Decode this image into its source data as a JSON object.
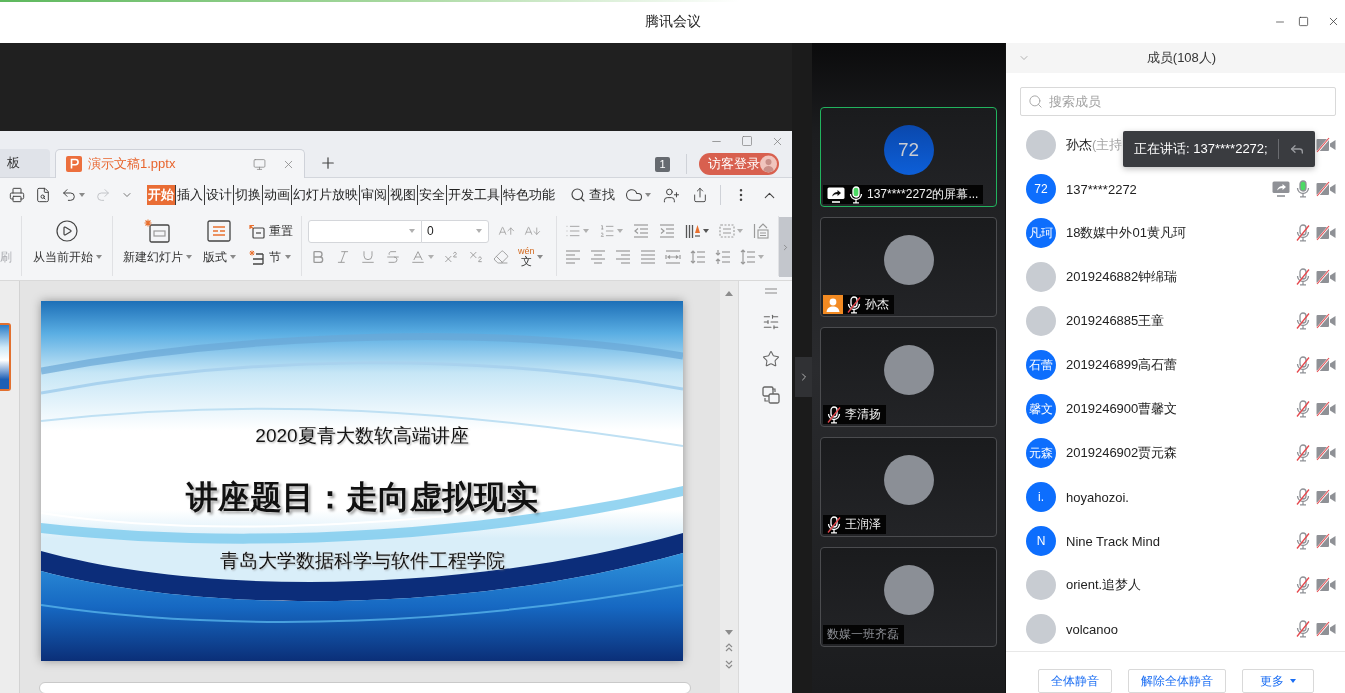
{
  "window": {
    "title": "腾讯会议"
  },
  "presentation": {
    "app_tabs": [
      {
        "label": "板",
        "selected": false
      },
      {
        "label": "演示文稿1.pptx",
        "selected": true
      }
    ],
    "notification_count": "1",
    "login_button": "访客登录",
    "redo": {
      "disabled": true
    },
    "menu_tabs": [
      {
        "label": "开始",
        "selected": true
      },
      {
        "label": "插入",
        "selected": false
      },
      {
        "label": "设计",
        "selected": false
      },
      {
        "label": "切换",
        "selected": false
      },
      {
        "label": "动画",
        "selected": false
      },
      {
        "label": "幻灯片放映",
        "selected": false
      },
      {
        "label": "审阅",
        "selected": false
      },
      {
        "label": "视图",
        "selected": false
      },
      {
        "label": "安全",
        "selected": false
      },
      {
        "label": "开发工具",
        "selected": false
      },
      {
        "label": "特色功能",
        "selected": false
      }
    ],
    "find_button": "查找",
    "ribbon": {
      "format_painter": {
        "label": "刷",
        "disabled": true
      },
      "play_button": "从当前开始",
      "new_slide_button": "新建幻灯片",
      "layout_button": "版式",
      "reset_button": "重置",
      "section_button": "节",
      "font_size": "0",
      "phonetic_button": {
        "pinyin": "wén",
        "character": "文"
      }
    },
    "slide": {
      "heading": "2020夏青大数软高端讲座",
      "title": "讲座题目：走向虚拟现实",
      "subtitle": "青岛大学数据科学与软件工程学院"
    }
  },
  "video_tiles": [
    {
      "name": "137****2272的屏幕...",
      "avatar": {
        "kind": "initials",
        "text": "72"
      },
      "speaking": true,
      "sharing": true,
      "host": false,
      "audio_connected": true,
      "muted": false
    },
    {
      "name": "孙杰",
      "avatar": {
        "kind": "photo"
      },
      "speaking": false,
      "sharing": false,
      "host": true,
      "audio_connected": true,
      "muted": true
    },
    {
      "name": "李清扬",
      "avatar": {
        "kind": "photo"
      },
      "speaking": false,
      "sharing": false,
      "host": false,
      "audio_connected": true,
      "muted": true
    },
    {
      "name": "王润泽",
      "avatar": {
        "kind": "photo"
      },
      "speaking": false,
      "sharing": false,
      "host": false,
      "audio_connected": true,
      "muted": true
    },
    {
      "name": "数媒一班齐磊",
      "avatar": {
        "kind": "photo"
      },
      "speaking": false,
      "sharing": false,
      "host": false,
      "audio_connected": false
    }
  ],
  "members_panel": {
    "title": "成员(108人)",
    "search": {
      "placeholder": "搜索成员"
    },
    "speaking_tooltip": "正在讲话: 137****2272;",
    "members": [
      {
        "name": "孙杰",
        "role": "(主持",
        "avatar": {
          "kind": "photo"
        },
        "sharing": false,
        "camera_off": true
      },
      {
        "name": "137****2272",
        "avatar": {
          "kind": "initials",
          "text": "72"
        },
        "sharing": true,
        "muted": false,
        "camera_off": true
      },
      {
        "name": "18数媒中外01黄凡珂",
        "avatar": {
          "kind": "initials",
          "text": "凡珂"
        },
        "sharing": false,
        "muted": true,
        "camera_off": true
      },
      {
        "name": "2019246882钟绵瑞",
        "avatar": {
          "kind": "photo"
        },
        "sharing": false,
        "muted": true,
        "camera_off": true
      },
      {
        "name": "2019246885王童",
        "avatar": {
          "kind": "photo"
        },
        "sharing": false,
        "muted": true,
        "camera_off": true
      },
      {
        "name": "2019246899高石蕾",
        "avatar": {
          "kind": "initials",
          "text": "石蕾"
        },
        "sharing": false,
        "muted": true,
        "camera_off": true
      },
      {
        "name": "2019246900曹馨文",
        "avatar": {
          "kind": "initials",
          "text": "馨文"
        },
        "sharing": false,
        "muted": true,
        "camera_off": true
      },
      {
        "name": "2019246902贾元森",
        "avatar": {
          "kind": "initials",
          "text": "元森"
        },
        "sharing": false,
        "muted": true,
        "camera_off": true
      },
      {
        "name": "hoyahozoi.",
        "avatar": {
          "kind": "initials",
          "text": "i."
        },
        "sharing": false,
        "muted": true,
        "camera_off": true
      },
      {
        "name": "Nine Track Mind",
        "avatar": {
          "kind": "initials",
          "text": "N"
        },
        "sharing": false,
        "muted": true,
        "camera_off": true
      },
      {
        "name": "orient.追梦人",
        "avatar": {
          "kind": "photo"
        },
        "sharing": false,
        "muted": true,
        "camera_off": true
      },
      {
        "name": "volcanoo",
        "avatar": {
          "kind": "photo"
        },
        "sharing": false,
        "muted": true,
        "camera_off": true
      }
    ],
    "buttons": [
      {
        "label": "全体静音",
        "menu": false
      },
      {
        "label": "解除全体静音",
        "menu": false
      },
      {
        "label": "更多",
        "menu": true
      }
    ]
  }
}
